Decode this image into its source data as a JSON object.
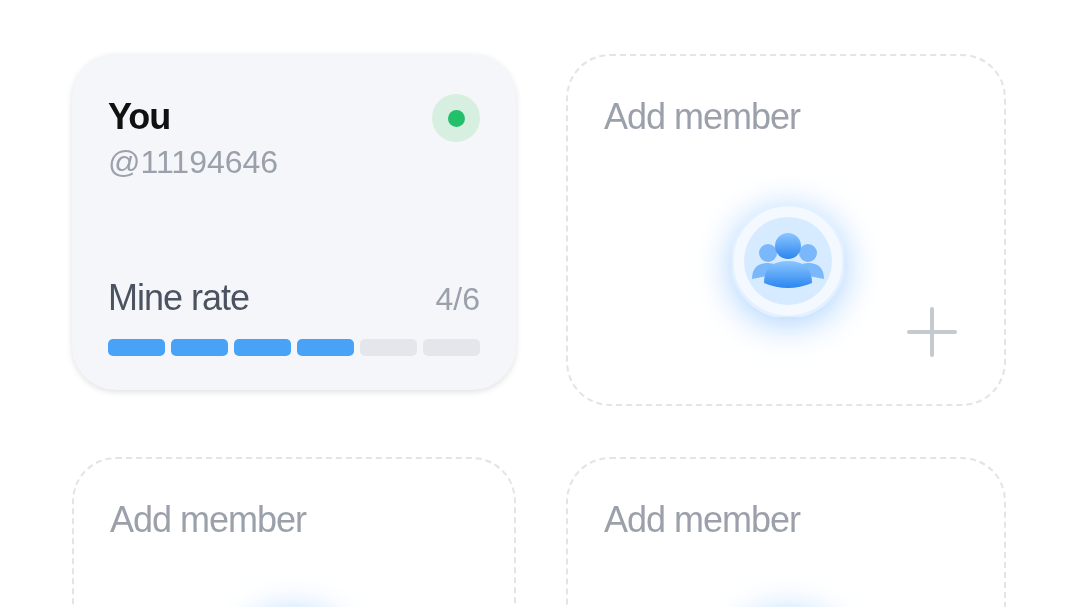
{
  "members": [
    {
      "kind": "self",
      "name": "You",
      "handle": "@11194646",
      "online": true,
      "rate_label": "Mine rate",
      "rate_value": "4/6",
      "segments": [
        {
          "filled": true
        },
        {
          "filled": true
        },
        {
          "filled": true
        },
        {
          "filled": true
        },
        {
          "filled": false
        },
        {
          "filled": false
        }
      ]
    },
    {
      "kind": "empty",
      "label": "Add member"
    },
    {
      "kind": "empty",
      "label": "Add member"
    },
    {
      "kind": "empty",
      "label": "Add member"
    }
  ]
}
